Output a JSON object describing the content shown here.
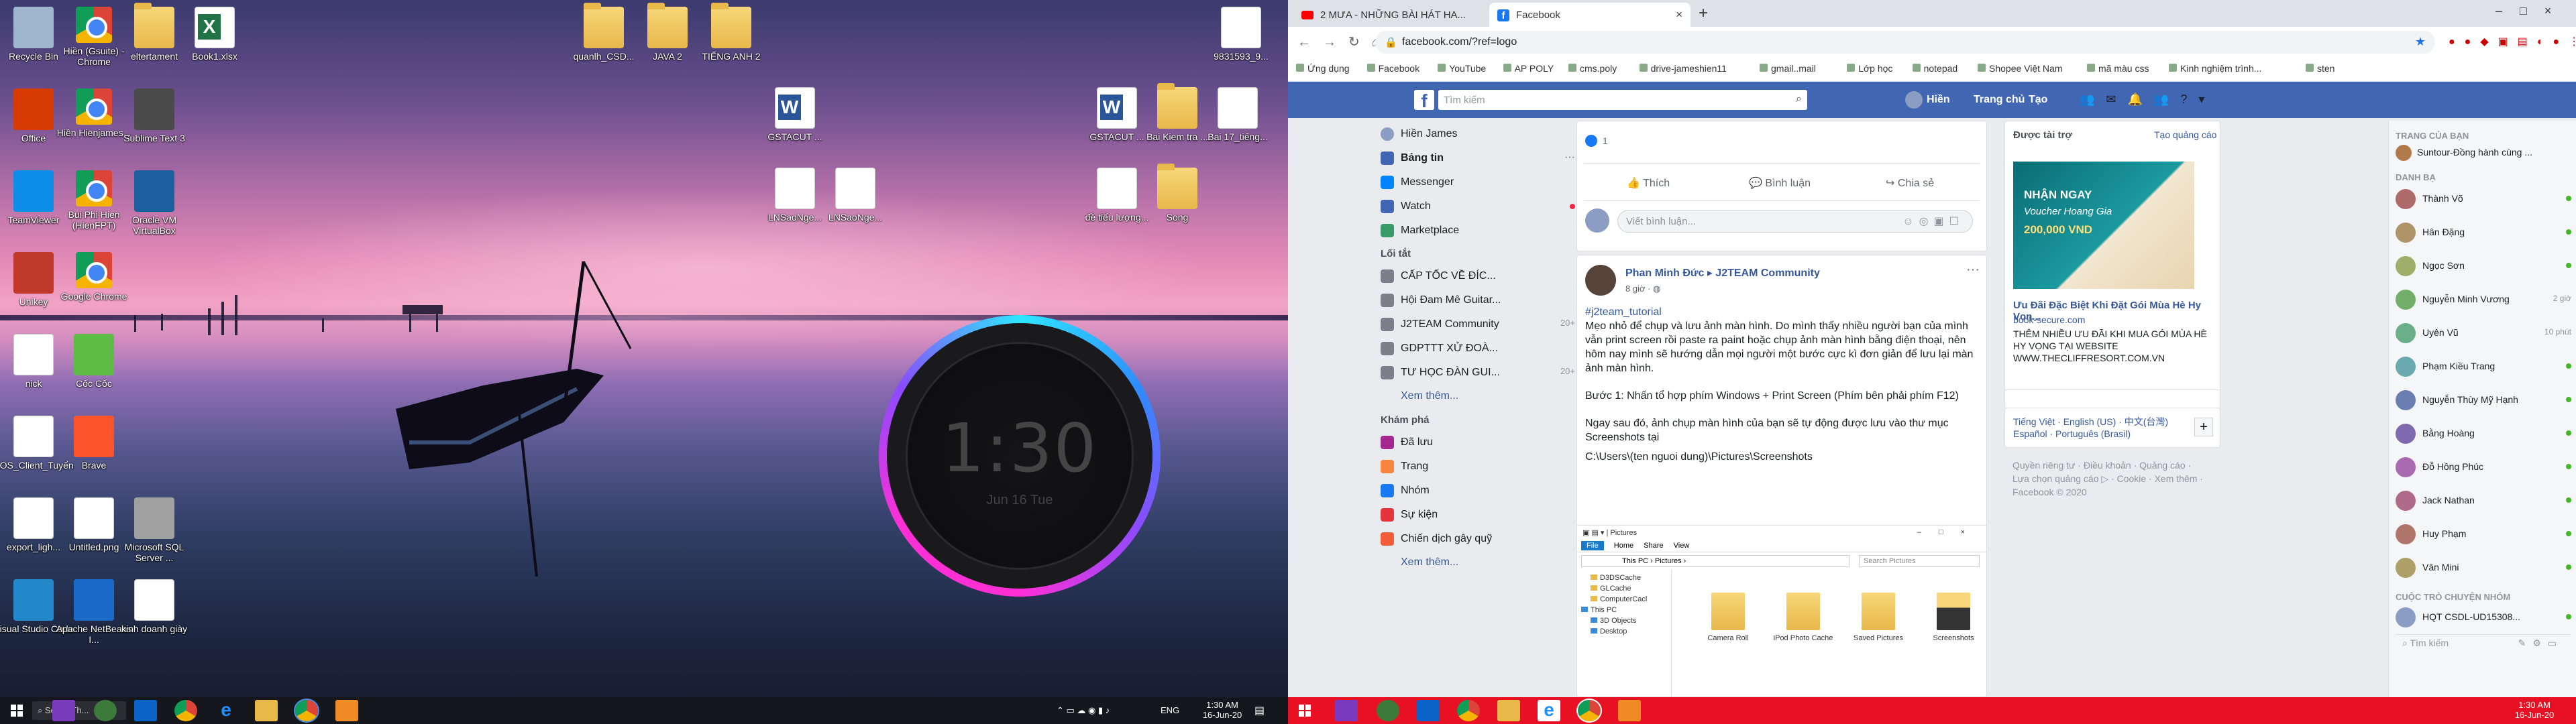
{
  "desktop": {
    "icons": [
      {
        "label": "Recycle Bin",
        "type": "recycle"
      },
      {
        "label": "Hiền (Gsuite) - Chrome",
        "type": "chrome"
      },
      {
        "label": "eltertament",
        "type": "folder"
      },
      {
        "label": "Book1.xlsx",
        "type": "excel"
      },
      {
        "label": "Office",
        "type": "office"
      },
      {
        "label": "Hiền Hienjames...",
        "type": "chrome"
      },
      {
        "label": "Sublime Text 3",
        "type": "sublime"
      },
      {
        "label": "TeamViewer",
        "type": "teamviewer"
      },
      {
        "label": "Bui Phi Hien (HienFPT)",
        "type": "chrome"
      },
      {
        "label": "Oracle VM VirtualBox",
        "type": "vbox"
      },
      {
        "label": "Unikey",
        "type": "unikey"
      },
      {
        "label": "Google Chrome",
        "type": "chrome"
      },
      {
        "label": "nick",
        "type": "doc"
      },
      {
        "label": "Cốc Cốc",
        "type": "coccoc"
      },
      {
        "label": "EOS_Client_Tuyển",
        "type": "doc"
      },
      {
        "label": "Brave",
        "type": "brave"
      },
      {
        "label": "export_ligh...",
        "type": "doc"
      },
      {
        "label": "Untitled.png",
        "type": "png"
      },
      {
        "label": "Microsoft SQL Server ...",
        "type": "sql"
      },
      {
        "label": "Visual Studio Code",
        "type": "vscode"
      },
      {
        "label": "Apache NetBeans I...",
        "type": "netbeans"
      },
      {
        "label": "kinh doanh giày",
        "type": "doc"
      }
    ],
    "top_icons": [
      {
        "label": "quanlh_CSD...",
        "type": "folder"
      },
      {
        "label": "JAVA 2",
        "type": "folder"
      },
      {
        "label": "TIẾNG ANH 2",
        "type": "folder"
      },
      {
        "label": "9831593_9...",
        "type": "doc"
      }
    ],
    "mid_icons": [
      {
        "label": "GSTACUT ...",
        "type": "word"
      },
      {
        "label": "GSTACUT ...",
        "type": "word"
      },
      {
        "label": "Bai Kiem tra ...",
        "type": "folder"
      },
      {
        "label": "Bai 17_tiếng...",
        "type": "doc"
      },
      {
        "label": "LNSaoNge...",
        "type": "pdf"
      },
      {
        "label": "LNSaoNge...",
        "type": "pdf"
      },
      {
        "label": "đề tiếu lượng...",
        "type": "pdf"
      },
      {
        "label": "Song",
        "type": "folder"
      }
    ],
    "clock": {
      "time": "1:30",
      "date": "Jun 16 Tue"
    },
    "taskbar": {
      "search_text": "Select Th...",
      "lang": "ENG",
      "time": "1:30 AM",
      "date": "16-Jun-20"
    }
  },
  "browser": {
    "tabs": [
      {
        "label": "2 MƯA - NHỮNG BÀI HÁT HA...",
        "icon": "youtube"
      },
      {
        "label": "Facebook",
        "icon": "facebook"
      }
    ],
    "url": "facebook.com/?ref=logo",
    "bookmarks": [
      "Ứng dụng",
      "Facebook",
      "YouTube",
      "AP POLY",
      "cms.poly",
      "drive-jameshien11",
      "gmail..mail",
      "Lớp học",
      "notepad",
      "Shopee Việt Nam",
      "mã màu css",
      "Kinh nghiệm trình...",
      "sten"
    ]
  },
  "facebook": {
    "search_placeholder": "Tìm kiếm",
    "profile_name": "Hiền",
    "nav": [
      "Trang chủ",
      "Tạo"
    ],
    "left": {
      "user": "Hiền James",
      "items": [
        "Bảng tin",
        "Messenger",
        "Watch",
        "Marketplace"
      ],
      "shortcuts_title": "Lối tắt",
      "shortcuts": [
        "CẤP TỐC VỀ ĐÍC...",
        "Hội Đam Mê Guitar...",
        "J2TEAM Community",
        "GDPTTT XỬ ĐOÀ...",
        "TƯ HỌC ĐÀN GUI..."
      ],
      "shortcut_counts": [
        "",
        "",
        "20+",
        "",
        "20+"
      ],
      "see_more": "Xem thêm...",
      "explore_title": "Khám phá",
      "explore": [
        "Đã lưu",
        "Trang",
        "Nhóm",
        "Sự kiện",
        "Chiến dịch gây quỹ"
      ],
      "see_more2": "Xem thêm..."
    },
    "feed": {
      "like_count": "1",
      "actions": [
        "Thích",
        "Bình luận",
        "Chia sẻ"
      ],
      "comment_placeholder": "Viết bình luận...",
      "post": {
        "author": "Phan Minh Đức ▸ J2TEAM Community",
        "time": "8 giờ · ",
        "hashtag": "#j2team_tutorial",
        "text1": "Mẹo nhỏ để chụp và lưu ảnh màn hình. Do mình thấy nhiều người bạn của mình vẫn print screen rồi paste ra paint hoặc chụp ảnh màn hình bằng điện thoại, nên hôm nay mình sẽ hướng dẫn mọi người một bước cực kì đơn giản để lưu lại màn ảnh màn hình.",
        "text2": "Bước 1: Nhấn tổ hợp phím Windows + Print Screen (Phím bên phải phím F12)",
        "text3": "Ngay sau đó, ảnh chụp màn hình của bạn sẽ tự động được lưu vào thư mục Screenshots tại",
        "text4": "C:\\Users\\(ten nguoi dung)\\Pictures\\Screenshots"
      },
      "explorer": {
        "title": "Pictures",
        "menu": [
          "File",
          "Home",
          "Share",
          "View"
        ],
        "path": "This PC › Pictures ›",
        "search": "Search Pictures",
        "sidebar": [
          "D3DSCache",
          "GLCache",
          "ComputerCacl",
          "This PC",
          "3D Objects",
          "Desktop"
        ],
        "folders": [
          "Camera Roll",
          "iPod Photo Cache",
          "Saved Pictures",
          "Screenshots"
        ]
      }
    },
    "sponsored": {
      "title": "Được tài trợ",
      "create": "Tạo quảng cáo",
      "ad_image_text1": "NHẬN NGAY",
      "ad_image_text2": "Voucher Hoang Gia",
      "ad_image_text3": "200,000 VND",
      "ad_title": "Ưu Đãi Đặc Biệt Khi Đặt Gói Mùa Hè Hy Vọn...",
      "ad_domain": "book-secure.com",
      "ad_text": "THÊM NHIỀU ƯU ĐÃI KHI MUA GÓI MÙA HÈ HY VỌNG TẠI WEBSITE WWW.THECLIFFRESORT.COM.VN",
      "langs": [
        "Tiếng Việt · English (US) · 中文(台灣)",
        "Español · Português (Brasil)"
      ],
      "footer1": "Quyền riêng tư · Điều khoản · Quảng cáo ·",
      "footer2": "Lựa chọn quảng cáo ▷ · Cookie · Xem thêm ·",
      "footer3": "Facebook © 2020"
    },
    "right": {
      "pages_title": "TRANG CỦA BẠN",
      "page": "Suntour-Đồng hành cùng ...",
      "contacts_title": "DANH BẠ",
      "contacts": [
        {
          "name": "Thành Võ",
          "status": "online"
        },
        {
          "name": "Hân Đặng",
          "status": "online"
        },
        {
          "name": "Ngọc Sơn",
          "status": "online"
        },
        {
          "name": "Nguyễn Minh Vương",
          "status": "2 giờ"
        },
        {
          "name": "Uyên Vũ",
          "status": "10 phút"
        },
        {
          "name": "Phạm Kiều Trang",
          "status": "online"
        },
        {
          "name": "Nguyễn Thùy Mỹ Hạnh",
          "status": "online"
        },
        {
          "name": "Bằng Hoàng",
          "status": "online"
        },
        {
          "name": "Đỗ Hồng Phúc",
          "status": "online"
        },
        {
          "name": "Jack Nathan",
          "status": "online"
        },
        {
          "name": "Huy Phạm",
          "status": "online"
        },
        {
          "name": "Vân Mini",
          "status": "online"
        }
      ],
      "group_title": "CUỘC TRÒ CHUYỆN NHÓM",
      "group": "HQT CSDL-UD15308...",
      "search": "Tìm kiếm"
    },
    "taskbar": {
      "time": "1:30 AM",
      "date": "16-Jun-20"
    }
  }
}
